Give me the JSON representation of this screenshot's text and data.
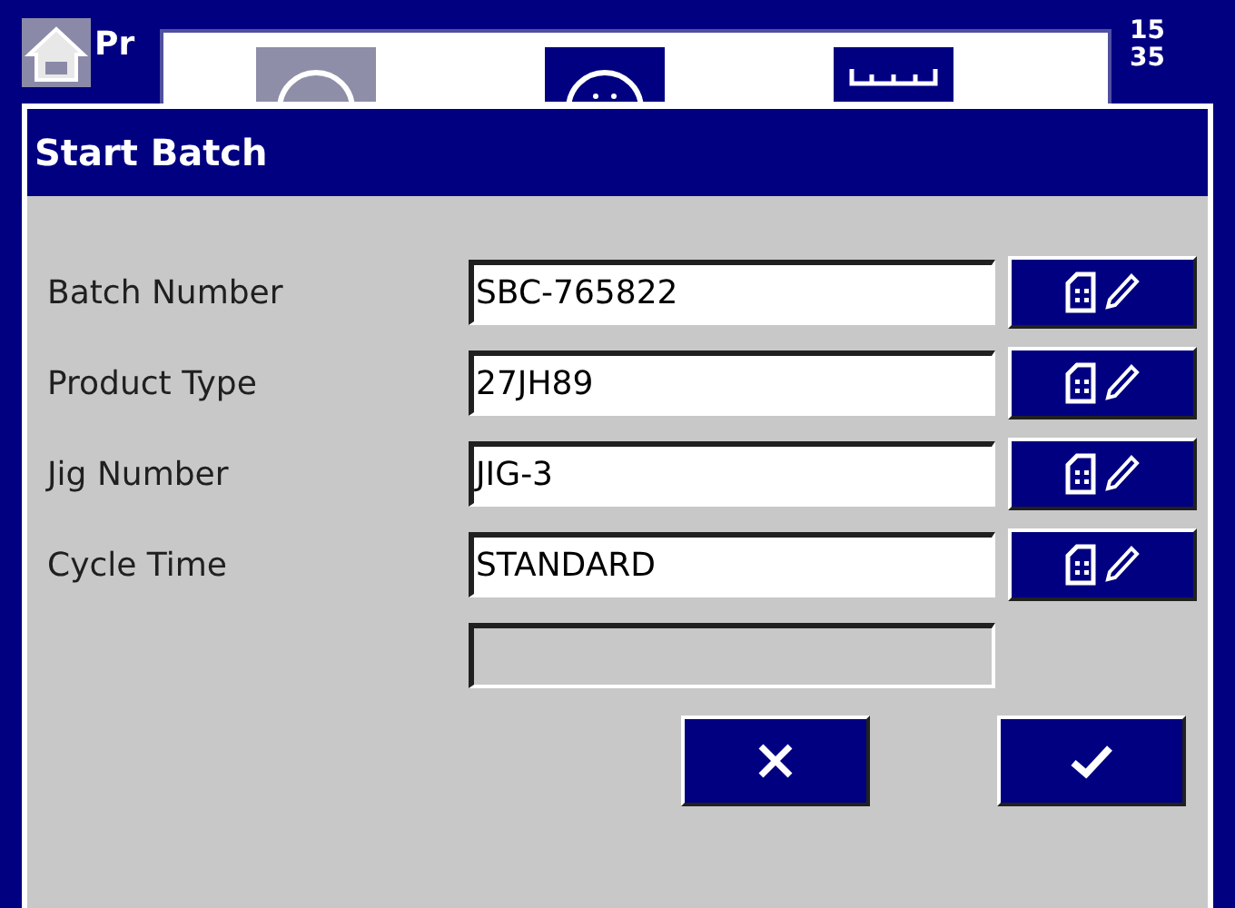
{
  "top_bar": {
    "app_label": "Pr",
    "clock": [
      "15",
      "35"
    ]
  },
  "dialog": {
    "title": "Start Batch",
    "fields": [
      {
        "label": "Batch Number",
        "value": "SBC-765822"
      },
      {
        "label": "Product Type",
        "value": "27JH89"
      },
      {
        "label": "Jig Number",
        "value": "JIG-3"
      },
      {
        "label": "Cycle Time",
        "value": "STANDARD"
      }
    ],
    "status_field": {
      "disabled": true
    },
    "buttons": [
      {
        "kind": "cancel"
      },
      {
        "kind": "confirm"
      }
    ]
  }
}
